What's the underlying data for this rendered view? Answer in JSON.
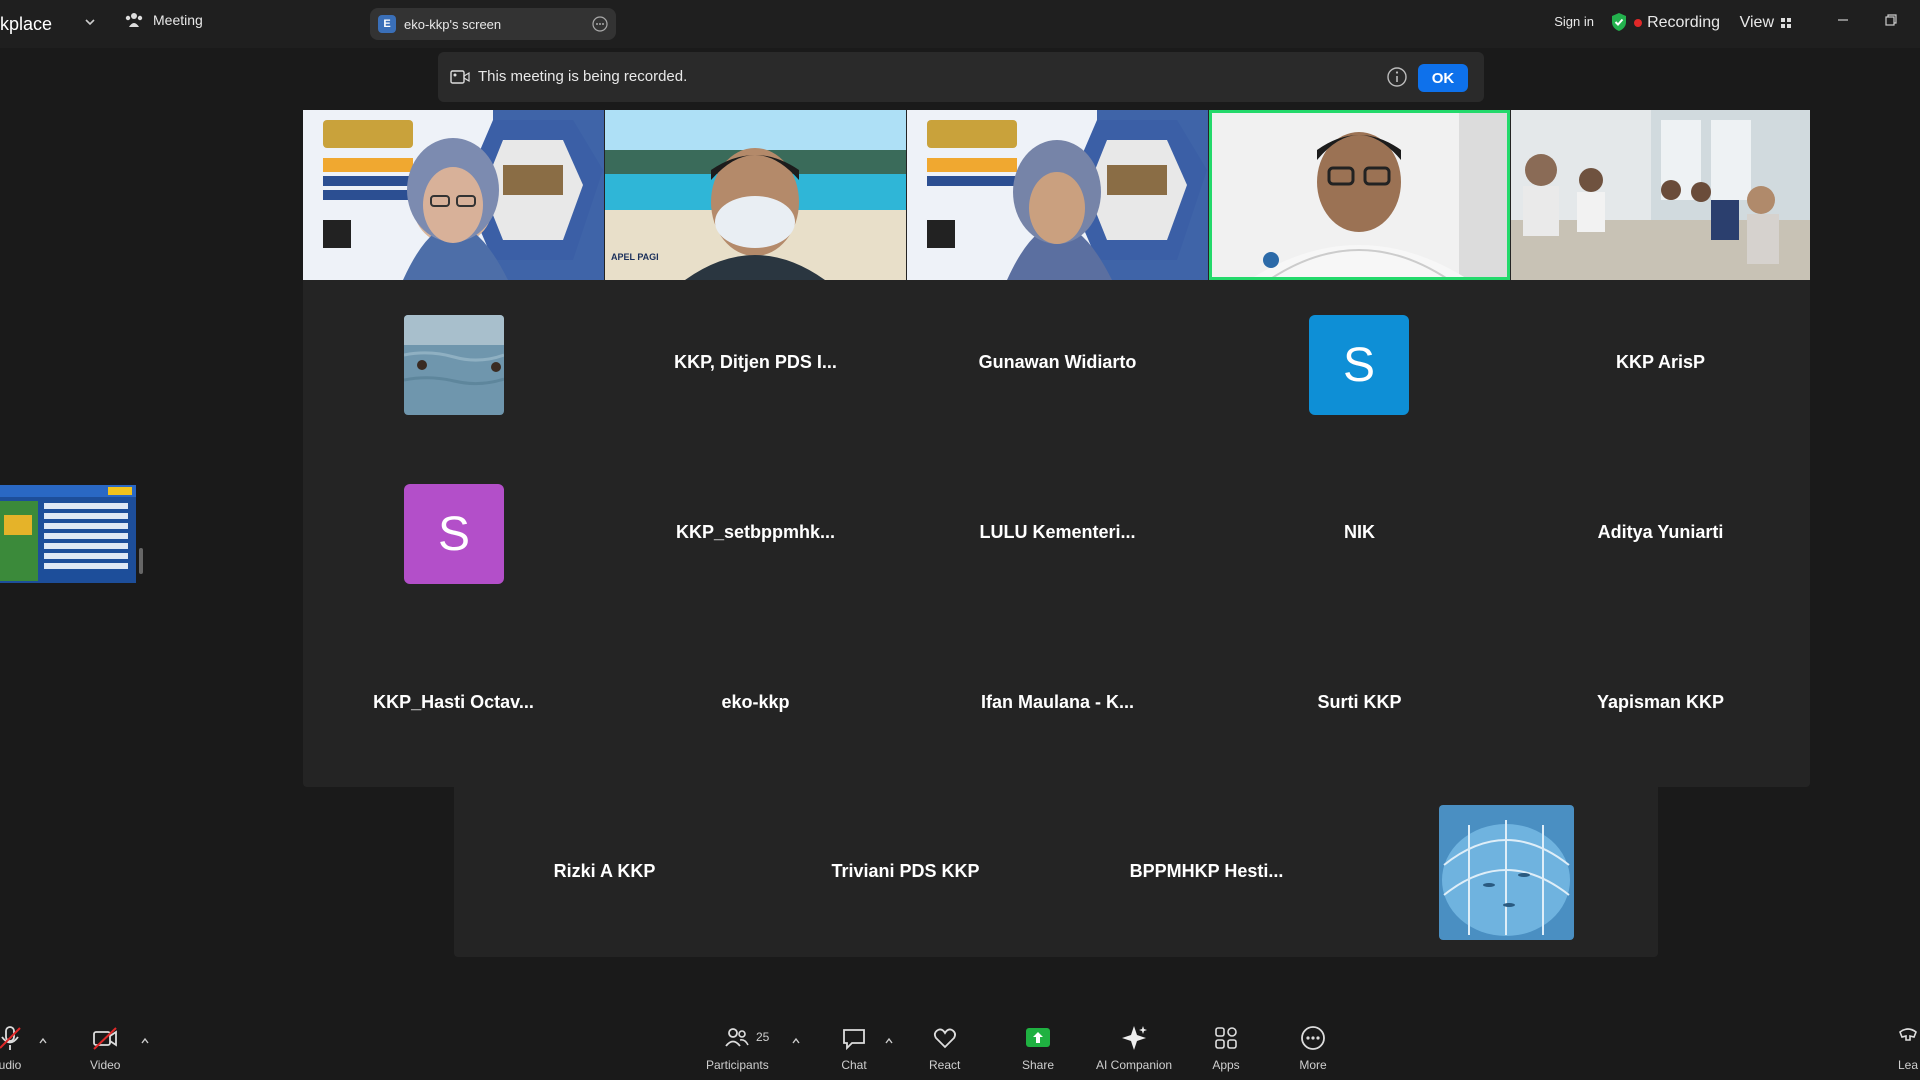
{
  "topbar": {
    "brand": "kplace",
    "meeting_label": "Meeting",
    "screen_chip": {
      "avatar": "E",
      "label": "eko-kkp's screen"
    },
    "sign_in": "Sign in",
    "recording": "Recording",
    "view": "View"
  },
  "banner": {
    "text": "This meeting is being recorded.",
    "ok": "OK"
  },
  "video_tiles": [
    {
      "name": "presenter-1",
      "scene": "slide-background"
    },
    {
      "name": "presenter-2",
      "scene": "beach-background",
      "slide_text": "APEL PAGI"
    },
    {
      "name": "presenter-3",
      "scene": "slide-background"
    },
    {
      "name": "presenter-4",
      "scene": "office",
      "active": true
    },
    {
      "name": "presenter-5",
      "scene": "meeting-room"
    }
  ],
  "name_tiles": [
    {
      "label": "",
      "kind": "thumb-sea"
    },
    {
      "label": "KKP, Ditjen PDS I...",
      "kind": "name"
    },
    {
      "label": "Gunawan Widiarto",
      "kind": "name"
    },
    {
      "label": "",
      "kind": "avatar",
      "letter": "S",
      "color": "#0e8fd6"
    },
    {
      "label": "KKP ArisP",
      "kind": "name"
    },
    {
      "label": "",
      "kind": "avatar",
      "letter": "S",
      "color": "#b34fc9"
    },
    {
      "label": "KKP_setbppmhk...",
      "kind": "name"
    },
    {
      "label": "LULU  Kementeri...",
      "kind": "name"
    },
    {
      "label": "NIK",
      "kind": "name"
    },
    {
      "label": "Aditya Yuniarti",
      "kind": "name"
    },
    {
      "label": "KKP_Hasti Octav...",
      "kind": "name"
    },
    {
      "label": "eko-kkp",
      "kind": "name"
    },
    {
      "label": "Ifan Maulana - K...",
      "kind": "name"
    },
    {
      "label": "Surti KKP",
      "kind": "name"
    },
    {
      "label": "Yapisman KKP",
      "kind": "name"
    }
  ],
  "bottom_tiles": [
    {
      "label": "Rizki A KKP",
      "kind": "name"
    },
    {
      "label": "Triviani PDS KKP",
      "kind": "name"
    },
    {
      "label": "BPPMHKP  Hesti...",
      "kind": "name"
    },
    {
      "label": "",
      "kind": "thumb-pool"
    }
  ],
  "toolbar": {
    "audio": "udio",
    "video": "Video",
    "participants": "Participants",
    "participants_count": "25",
    "chat": "Chat",
    "react": "React",
    "share": "Share",
    "ai_companion": "AI Companion",
    "apps": "Apps",
    "more": "More",
    "leave": "Lea"
  },
  "colors": {
    "accent": "#0e71eb",
    "active_speaker": "#23d96b",
    "recording": "#e02828",
    "share_green": "#1fb141"
  }
}
